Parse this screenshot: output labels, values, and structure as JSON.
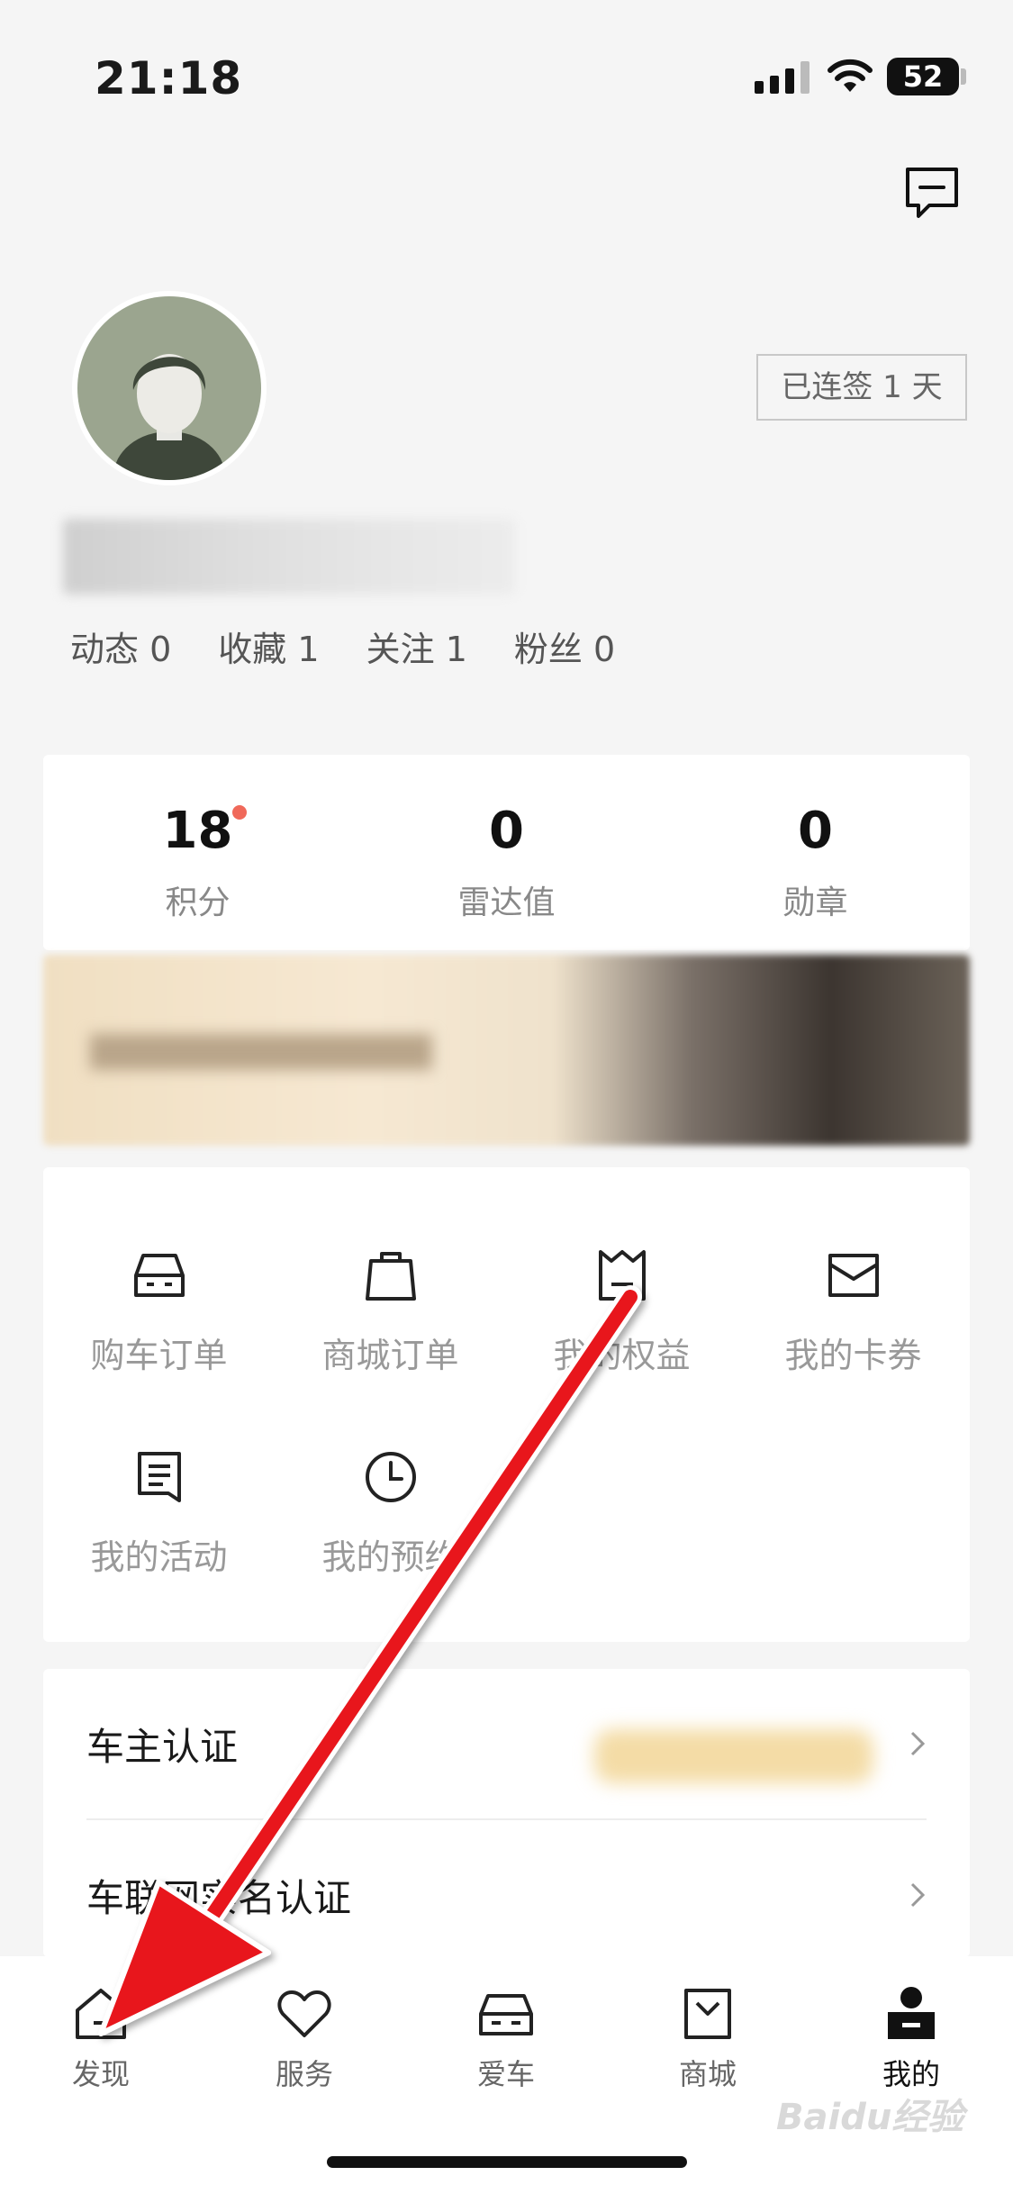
{
  "status_bar": {
    "time": "21:18",
    "battery": "52"
  },
  "profile": {
    "signin_badge": "已连签 1 天",
    "stats": [
      {
        "label": "动态",
        "count": "0"
      },
      {
        "label": "收藏",
        "count": "1"
      },
      {
        "label": "关注",
        "count": "1"
      },
      {
        "label": "粉丝",
        "count": "0"
      }
    ]
  },
  "points": [
    {
      "value": "18",
      "label": "积分",
      "has_dot": true
    },
    {
      "value": "0",
      "label": "雷达值"
    },
    {
      "value": "0",
      "label": "勋章"
    }
  ],
  "shortcuts": [
    {
      "label": "购车订单",
      "icon": "car-icon"
    },
    {
      "label": "商城订单",
      "icon": "shopping-bag-icon"
    },
    {
      "label": "我的权益",
      "icon": "crown-icon"
    },
    {
      "label": "我的卡券",
      "icon": "coupon-icon"
    },
    {
      "label": "我的活动",
      "icon": "document-icon"
    },
    {
      "label": "我的预约",
      "icon": "clock-icon"
    }
  ],
  "list": [
    {
      "label": "车主认证"
    },
    {
      "label": "车联网实名认证"
    }
  ],
  "tabbar": [
    {
      "label": "发现",
      "icon": "home-icon"
    },
    {
      "label": "服务",
      "icon": "heart-icon"
    },
    {
      "label": "爱车",
      "icon": "car-icon"
    },
    {
      "label": "商城",
      "icon": "shopping-bag-icon"
    },
    {
      "label": "我的",
      "icon": "profile-icon",
      "active": true
    }
  ],
  "watermark": "Baidu经验",
  "colors": {
    "accent_dot": "#f0695a",
    "arrow": "#e8141b"
  }
}
